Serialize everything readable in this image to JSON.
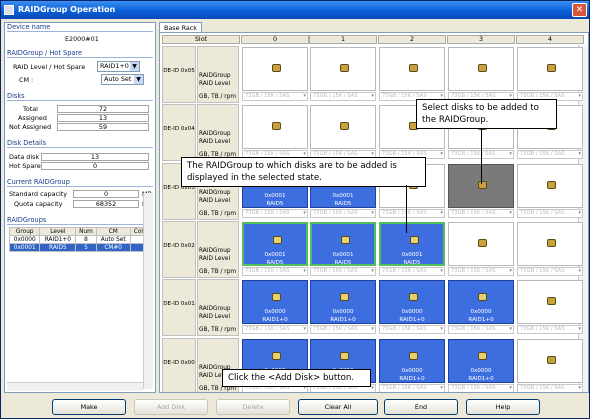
{
  "window": {
    "title": "RAIDGroup Operation",
    "close_label": "✕"
  },
  "left": {
    "device_name_header": "Device name",
    "device_name": "E2000#01",
    "raid_hotspare_header": "RAIDGroup / Hot Spare",
    "raid_level_label": "RAID Level / Hot Spare",
    "raid_level_value": "RAID1+0",
    "cm_label": "CM :",
    "cm_value": "Auto Set",
    "disks_header": "Disks",
    "total_label": "Total",
    "total_value": "72",
    "assigned_label": "Assigned",
    "assigned_value": "13",
    "not_assigned_label": "Not Assigned",
    "not_assigned_value": "59",
    "disk_details_header": "Disk Details",
    "data_disk_label": "Data disk",
    "data_disk_value": "13",
    "hot_spare_label": "Hot Spare",
    "hot_spare_value": "0",
    "current_header": "Current RAIDGroup",
    "std_cap_label": "Standard capacity",
    "std_cap_value": "0",
    "std_cap_unit": "MB",
    "quota_label": "Quota capacity",
    "quota_value": "68352",
    "quota_unit": "MB",
    "raidgroups_header": "RAIDGroups",
    "table_headers": [
      "Group",
      "Level",
      "Num",
      "CM",
      "Color"
    ],
    "rows": [
      [
        "0x0000",
        "RAID1+0",
        "8",
        "Auto Set",
        ""
      ],
      [
        "0x0001",
        "RAID5",
        "5",
        "CM#0",
        ""
      ]
    ]
  },
  "right": {
    "tab": "Base Rack",
    "slot_header": "Slot",
    "columns": [
      "0",
      "1",
      "2",
      "3",
      "4"
    ],
    "row_labels": [
      "DE-ID 0x05",
      "DE-ID 0x04",
      "DE-ID 0x03",
      "DE-ID 0x02",
      "DE-ID 0x01",
      "DE-ID 0x00"
    ],
    "info_raidgroup": "RAIDGroup",
    "info_raidlevel": "RAID Level",
    "info_capacity": "GB, TB / rpm",
    "cap_text": "73GB / 15K / SAS",
    "g0001": "0x0001",
    "g0000": "0x0000",
    "raid5": "RAID5",
    "raid10": "RAID1+0"
  },
  "callouts": {
    "select_disks": "Select disks to be added to the RAIDGroup.",
    "raidgroup_state": "The RAIDGroup to which disks are to be added is displayed in the selected state.",
    "add_disk": "Click the <Add Disk> button."
  },
  "buttons": {
    "make": "Make",
    "add_disk": "Add Disk",
    "delete": "Delete",
    "clear_all": "Clear All",
    "end": "End",
    "help": "Help"
  },
  "colors": {
    "title_bar": "#0a5fd8",
    "raid_blue": "#3d6ee0",
    "selected_green": "#4fc05a",
    "gray": "#7a7a7a"
  }
}
